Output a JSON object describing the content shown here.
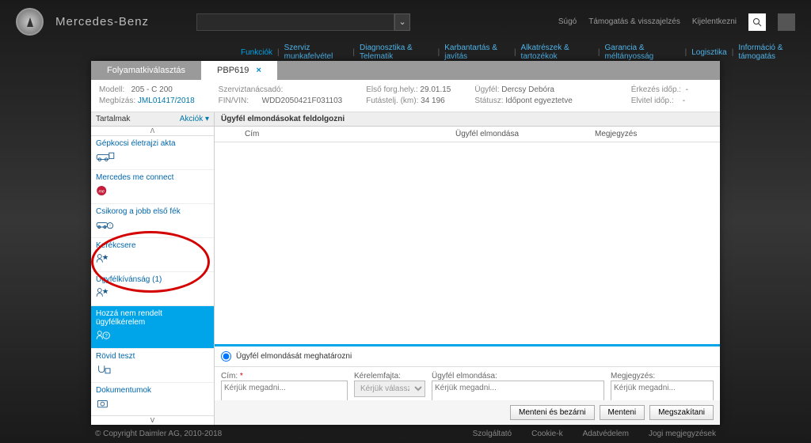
{
  "brand": "Mercedes-Benz",
  "top": {
    "sugo": "Súgó",
    "tamogatas": "Támogatás & visszajelzés",
    "kijelentkezni": "Kijelentkezni"
  },
  "nav": {
    "funkciok": "Funkciók",
    "items": [
      "Szerviz munkafelvétel",
      "Diagnosztika & Telematik",
      "Karbantartás & javítás",
      "Alkatrészek & tartozékok",
      "Garancia & méltányosság",
      "Logisztika",
      "Információ & támogatás"
    ]
  },
  "tabs": {
    "t1": "Folyamatkiválasztás",
    "t2": "PBP619"
  },
  "info": {
    "modell_lbl": "Modell:",
    "modell": "205 - C 200",
    "megbizas_lbl": "Megbízás:",
    "megbizas": "JML01417/2018",
    "szerviz_lbl": "Szerviztanácsadó:",
    "szerviz": "",
    "fin_lbl": "FIN/VIN:",
    "fin": "WDD2050421F031103",
    "elso_lbl": "Első forg.hely.:",
    "elso": "29.01.15",
    "futas_lbl": "Futástelj. (km):",
    "futas": "34 196",
    "ugyfel_lbl": "Ügyfél:",
    "ugyfel": "Dercsy Debóra",
    "statusz_lbl": "Státusz:",
    "statusz": "Időpont egyeztetve",
    "erk_lbl": "Érkezés időp.:",
    "erk": "-",
    "elv_lbl": "Elvitel időp.:",
    "elv": "-"
  },
  "sidebar": {
    "title": "Tartalmak",
    "akciok": "Akciók ▾",
    "items": [
      {
        "label": "Gépkocsi életrajzi akta"
      },
      {
        "label": "Mercedes me connect"
      },
      {
        "label": "Csikorog a jobb első fék"
      },
      {
        "label": "Kerékcsere"
      },
      {
        "label": "Ügyfélkívánság (1)"
      },
      {
        "label": "Hozzá nem rendelt ügyfélkérelem",
        "sel": true
      },
      {
        "label": "Rövid teszt"
      },
      {
        "label": "Dokumentumok"
      }
    ]
  },
  "pane": {
    "title": "Ügyfél elmondásokat feldolgozni",
    "col_cim": "Cím",
    "col_elm": "Ügyfél elmondása",
    "col_meg": "Megjegyzés",
    "radio": "Ügyfél elmondását meghatározni",
    "cim_lbl": "Cím:",
    "cim_ph": "Kérjük megadni...",
    "ker_lbl": "Kérelemfajta:",
    "ker_opt": "Kérjük válasszon...",
    "elm_lbl": "Ügyfél elmondása:",
    "elm_ph": "Kérjük megadni...",
    "meg_lbl": "Megjegyzés:",
    "meg_ph": "Kérjük megadni..."
  },
  "buttons": {
    "save_close": "Menteni és bezárni",
    "save": "Menteni",
    "cancel": "Megszakítani"
  },
  "footer": {
    "copy": "© Copyright Daimler AG, 2010-2018",
    "szolg": "Szolgáltató",
    "cookie": "Cookie-k",
    "adat": "Adatvédelem",
    "jogi": "Jogi megjegyzések"
  }
}
